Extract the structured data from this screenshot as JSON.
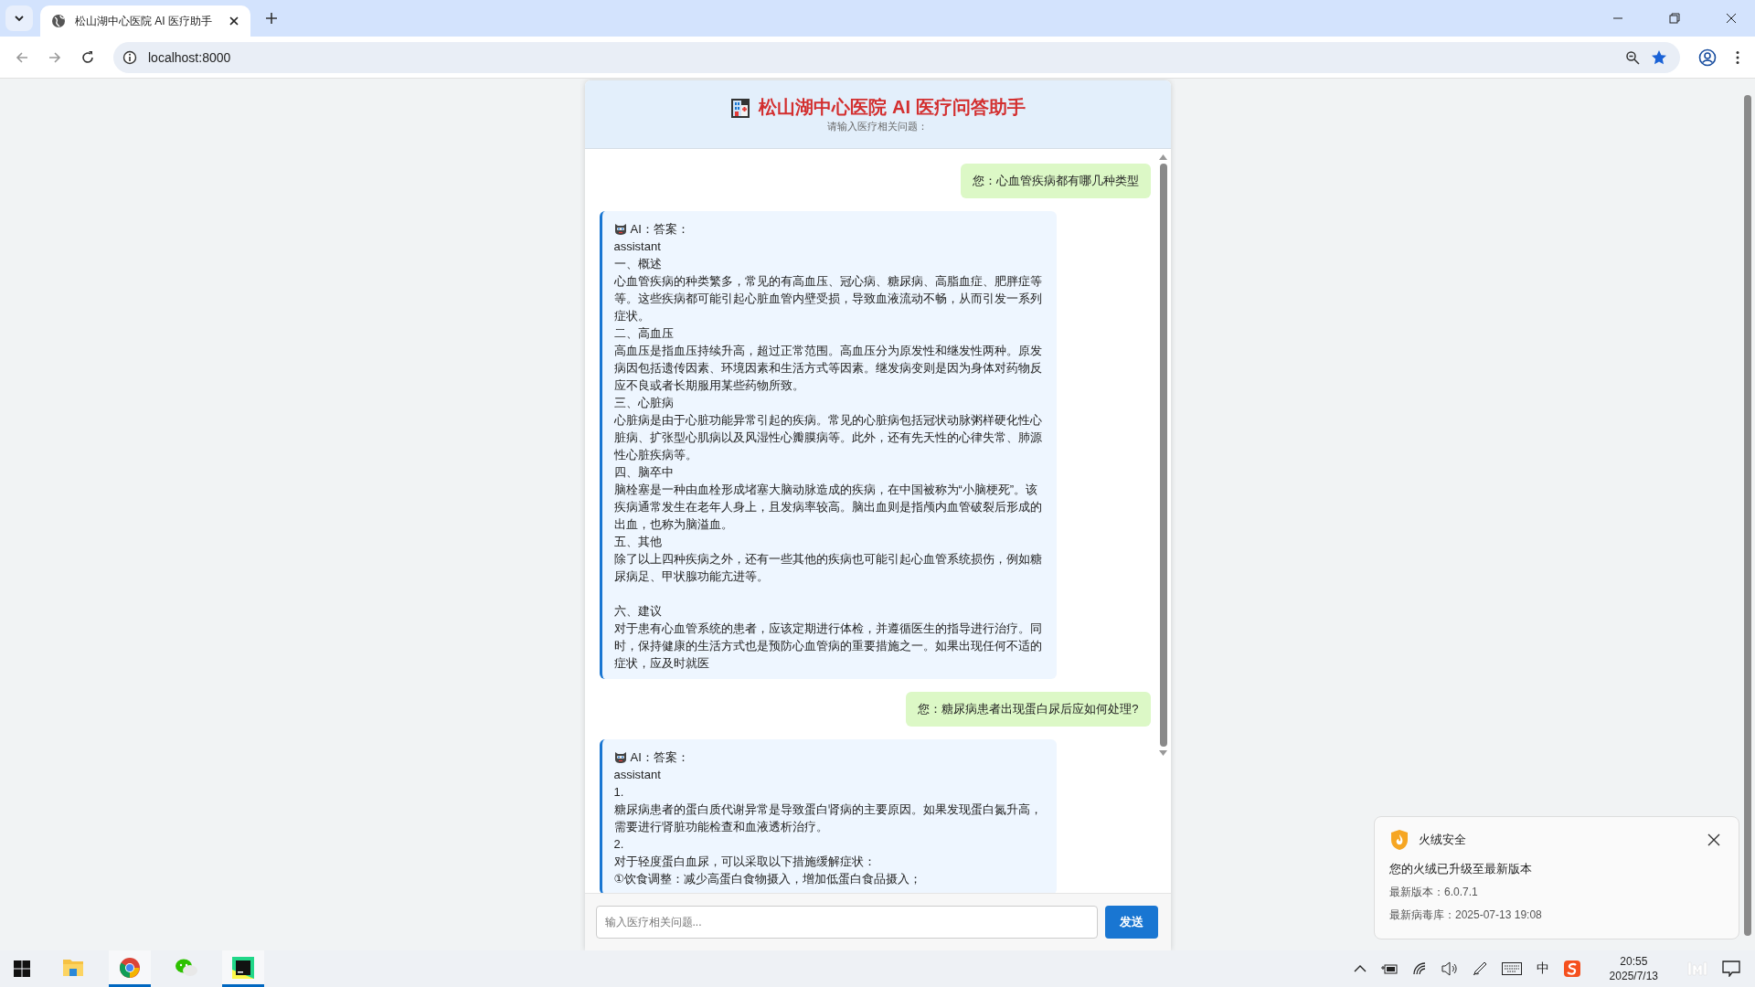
{
  "browser": {
    "tab_title": "松山湖中心医院 AI 医疗助手",
    "address": "localhost:8000"
  },
  "chat": {
    "title": "松山湖中心医院 AI 医疗问答助手",
    "subtitle": "请输入医疗相关问题：",
    "messages": [
      {
        "kind": "user",
        "text": "您：心血管疾病都有哪几种类型"
      },
      {
        "kind": "ai",
        "label": "AI：答案：",
        "blocks": [
          [
            "assistant",
            "一、概述",
            "心血管疾病的种类繁多，常见的有高血压、冠心病、糖尿病、高脂血症、肥胖症等等。这些疾病都可能引起心脏血管内壁受损，导致血液流动不畅，从而引发一系列症状。",
            "二、高血压",
            "高血压是指血压持续升高，超过正常范围。高血压分为原发性和继发性两种。原发病因包括遗传因素、环境因素和生活方式等因素。继发病变则是因为身体对药物反应不良或者长期服用某些药物所致。",
            "三、心脏病",
            "心脏病是由于心脏功能异常引起的疾病。常见的心脏病包括冠状动脉粥样硬化性心脏病、扩张型心肌病以及风湿性心瓣膜病等。此外，还有先天性的心律失常、肺源性心脏疾病等。",
            "四、脑卒中",
            "脑栓塞是一种由血栓形成堵塞大脑动脉造成的疾病，在中国被称为“小脑梗死”。该疾病通常发生在老年人身上，且发病率较高。脑出血则是指颅内血管破裂后形成的出血，也称为脑溢血。",
            "五、其他",
            "除了以上四种疾病之外，还有一些其他的疾病也可能引起心血管系统损伤，例如糖尿病足、甲状腺功能亢进等。"
          ],
          [
            "六、建议",
            "对于患有心血管系统的患者，应该定期进行体检，并遵循医生的指导进行治疗。同时，保持健康的生活方式也是预防心血管病的重要措施之一。如果出现任何不适的症状，应及时就医"
          ]
        ]
      },
      {
        "kind": "user",
        "text": "您：糖尿病患者出现蛋白尿后应如何处理?"
      },
      {
        "kind": "ai",
        "label": "AI：答案：",
        "blocks": [
          [
            "assistant",
            "1.",
            "糖尿病患者的蛋白质代谢异常是导致蛋白肾病的主要原因。如果发现蛋白氮升高，需要进行肾脏功能检查和血液透析治疗。",
            "2.",
            "对于轻度蛋白血尿，可以采取以下措施缓解症状：",
            "①饮食调整：减少高蛋白食物摄入，增加低蛋白食品摄入；"
          ]
        ]
      }
    ],
    "input": {
      "placeholder": "输入医疗相关问题..."
    },
    "send_button": "发送"
  },
  "notification": {
    "app": "火绒安全",
    "message": "您的火绒已升级至最新版本",
    "details": [
      "最新版本：6.0.7.1",
      "最新病毒库：2025-07-13 19:08"
    ]
  },
  "taskbar": {
    "apps": [
      {
        "kind": "explorer",
        "active": false
      },
      {
        "kind": "chrome",
        "active": true
      },
      {
        "kind": "wechat",
        "active": false
      },
      {
        "kind": "pycharm",
        "active": true
      }
    ],
    "ime": "中",
    "time": "20:55",
    "date": "2025/7/13"
  }
}
